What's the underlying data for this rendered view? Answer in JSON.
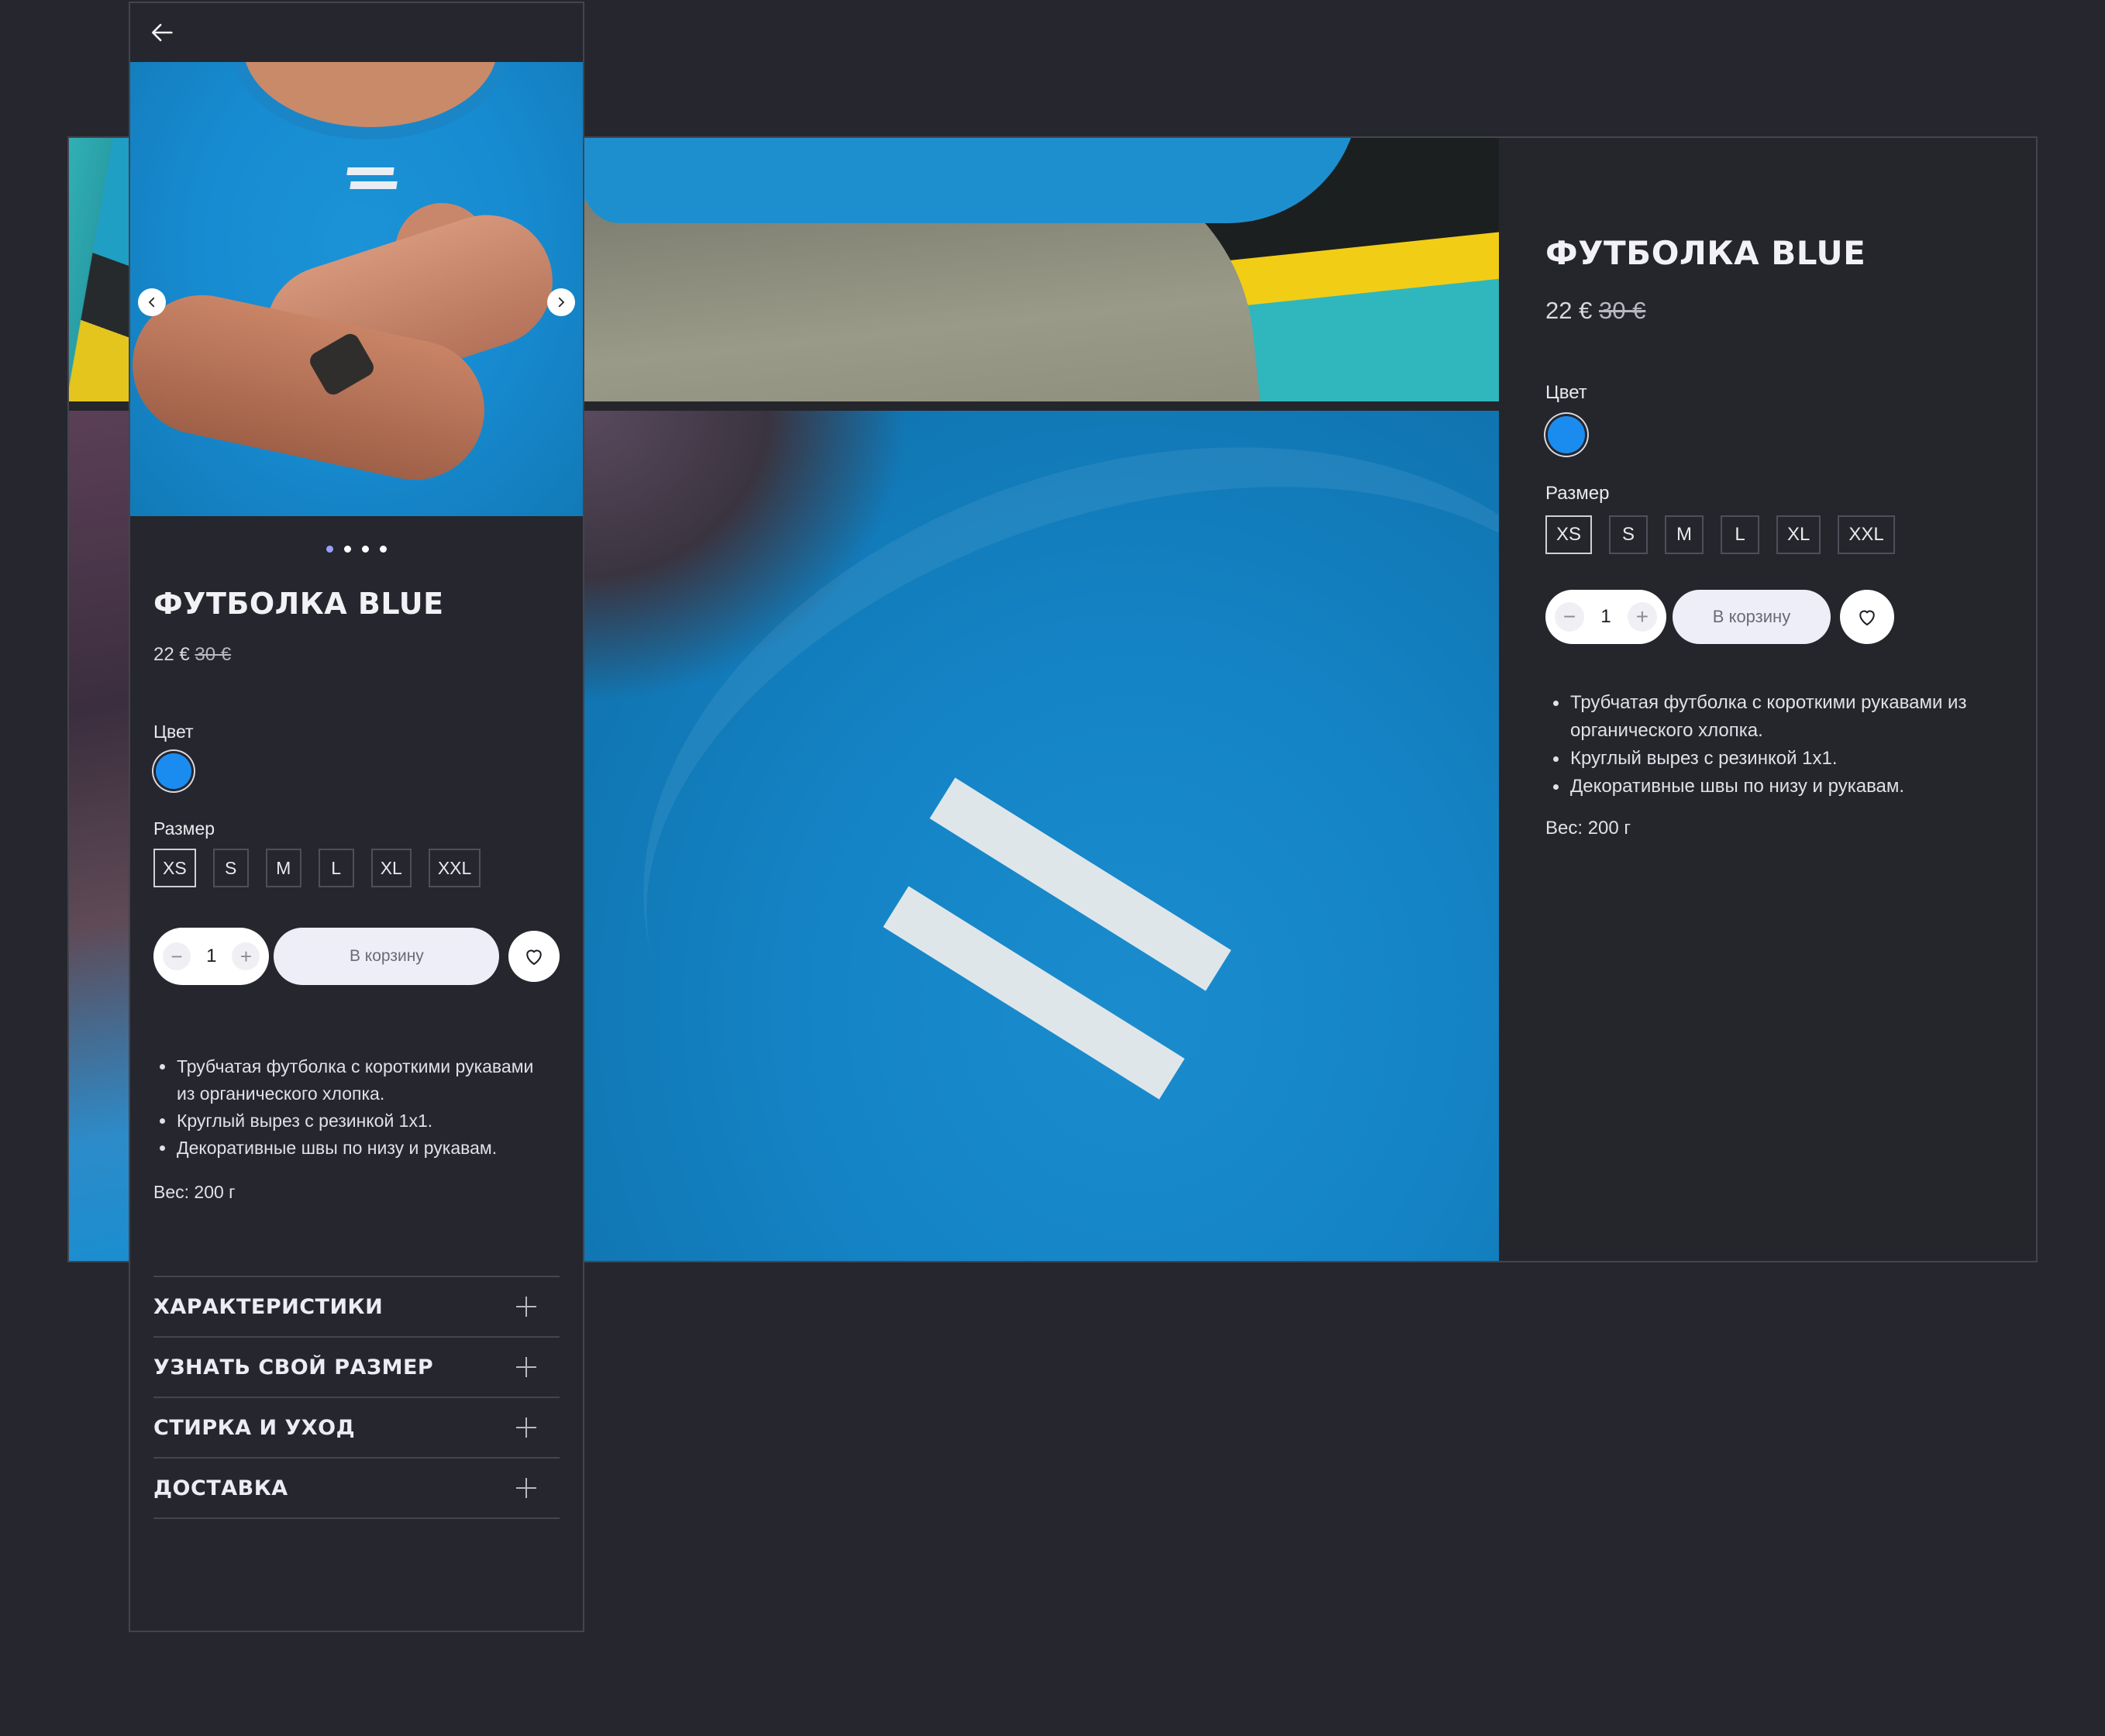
{
  "product": {
    "title": "ФУТБОЛКА BLUE",
    "price_current": "22 €",
    "price_old": "30 €",
    "color_label": "Цвет",
    "color_value": "#1a8cf0",
    "size_label": "Размер",
    "sizes": [
      "XS",
      "S",
      "M",
      "L",
      "XL",
      "XXL"
    ],
    "selected_size": "XS",
    "quantity": "1",
    "minus_symbol": "−",
    "plus_symbol": "+",
    "cart_label": "В корзину",
    "bullets_desktop": [
      "Трубчатая футболка с короткими рукавами из",
      "органического хлопка.",
      "Круглый вырез с резинкой 1x1.",
      "Декоративные швы по низу и рукавам."
    ],
    "bullets_mobile": [
      "Трубчатая футболка с короткими рукавами",
      "из органического хлопка.",
      "Круглый вырез с резинкой 1x1.",
      "Декоративные швы по низу и рукавам."
    ],
    "weight": "Вес: 200 г"
  },
  "gallery": {
    "dots_count": 4,
    "active_dot": 0
  },
  "accordion": [
    "ХАРАКТЕРИСТИКИ",
    "УЗНАТЬ СВОЙ РАЗМЕР",
    "СТИРКА И УХОД",
    "ДОСТАВКА"
  ],
  "icons": {
    "back": "arrow-left-icon",
    "prev": "chevron-left-icon",
    "next": "chevron-right-icon",
    "favorite": "heart-icon",
    "expand": "plus-icon"
  }
}
